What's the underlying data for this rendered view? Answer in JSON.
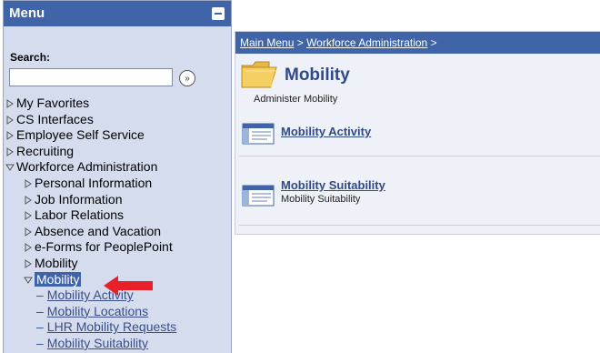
{
  "menu": {
    "title": "Menu",
    "search_label": "Search:",
    "search_value": "",
    "search_go_glyph": "»",
    "items": [
      {
        "label": "My Favorites"
      },
      {
        "label": "CS Interfaces"
      },
      {
        "label": "Employee Self Service"
      },
      {
        "label": "Recruiting"
      },
      {
        "label": "Workforce Administration"
      }
    ],
    "sub_items": [
      {
        "label": "Personal Information"
      },
      {
        "label": "Job Information"
      },
      {
        "label": "Labor Relations"
      },
      {
        "label": "Absence and Vacation"
      },
      {
        "label": "e-Forms for PeoplePoint"
      },
      {
        "label": "Mobility"
      },
      {
        "label": "Mobility"
      }
    ],
    "leaf_items": [
      {
        "label": "Mobility Activity"
      },
      {
        "label": "Mobility Locations"
      },
      {
        "label": "LHR Mobility Requests"
      },
      {
        "label": "Mobility Suitability"
      }
    ]
  },
  "content": {
    "breadcrumb": {
      "part1": "Main Menu",
      "sep1": " > ",
      "part2": "Workforce Administration",
      "sep2": " >"
    },
    "title": "Mobility",
    "description": "Administer Mobility",
    "items": [
      {
        "label": "Mobility Activity",
        "description": ""
      },
      {
        "label": "Mobility Suitability",
        "description": "Mobility Suitability"
      }
    ]
  },
  "colors": {
    "header_blue": "#3f64a7",
    "menu_bg": "#d4dced",
    "arrow_red": "#e8202a"
  },
  "icons": [
    "collapse-icon",
    "search-go-icon",
    "folder-icon",
    "component-icon",
    "red-arrow-icon",
    "triangle-right-icon",
    "triangle-down-icon"
  ]
}
